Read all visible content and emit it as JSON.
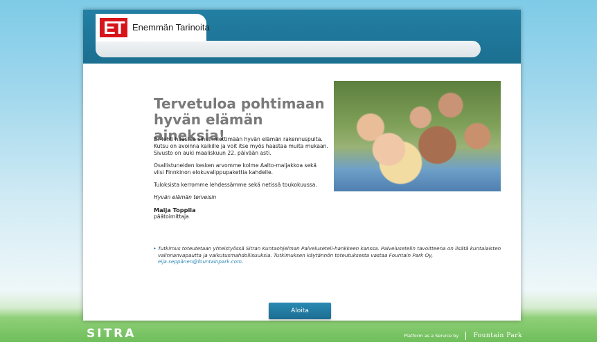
{
  "header": {
    "logo_mark": "ET",
    "logo_text": "Enemmän Tarinoita"
  },
  "main": {
    "title": "Tervetuloa pohtimaan hyvän elämän aineksia!",
    "paragraphs": [
      "ET-lehti haastaa sinut miettimään hyvän elämän rakennuspuita. Kutsu on avoinna kaikille ja voit itse myös haastaa muita mukaan. Sivusto on auki maaliskuun 22. päivään asti.",
      "Osallistuneiden kesken arvomme kolme Aalto-maljakkoa sekä viisi Finnkinon elokuvalippupakettia kahdelle.",
      "Tuloksista kerromme lehdessämme sekä netissä toukokuussa."
    ],
    "greeting": "Hyvän elämän terveisin",
    "signer_name": "Maija Toppila",
    "signer_title": "päätoimittaja",
    "note_text": "Tutkimus toteutetaan yhteistyössä Sitran Kuntaohjelman Palveluseteli-hankkeen kanssa.  Palvelusetelin tavoitteena on lisätä kuntalaisten valinnanvapautta ja vaikutusmahdollisuuksia. Tutkimuksen käytännön toteutuksesta vastaa Fountain Park Oy, ",
    "note_email": "eija.seppänen@fountainpark.com",
    "note_end": ".",
    "start_button": "Aloita"
  },
  "footer": {
    "sitra_logo": "SITRA",
    "platform_text": "Platform as a Service by",
    "fountain_park": "Fountain Park"
  },
  "colors": {
    "brand_red": "#d7141a",
    "header_blue": "#1f77a0",
    "link_blue": "#2a86b5"
  }
}
